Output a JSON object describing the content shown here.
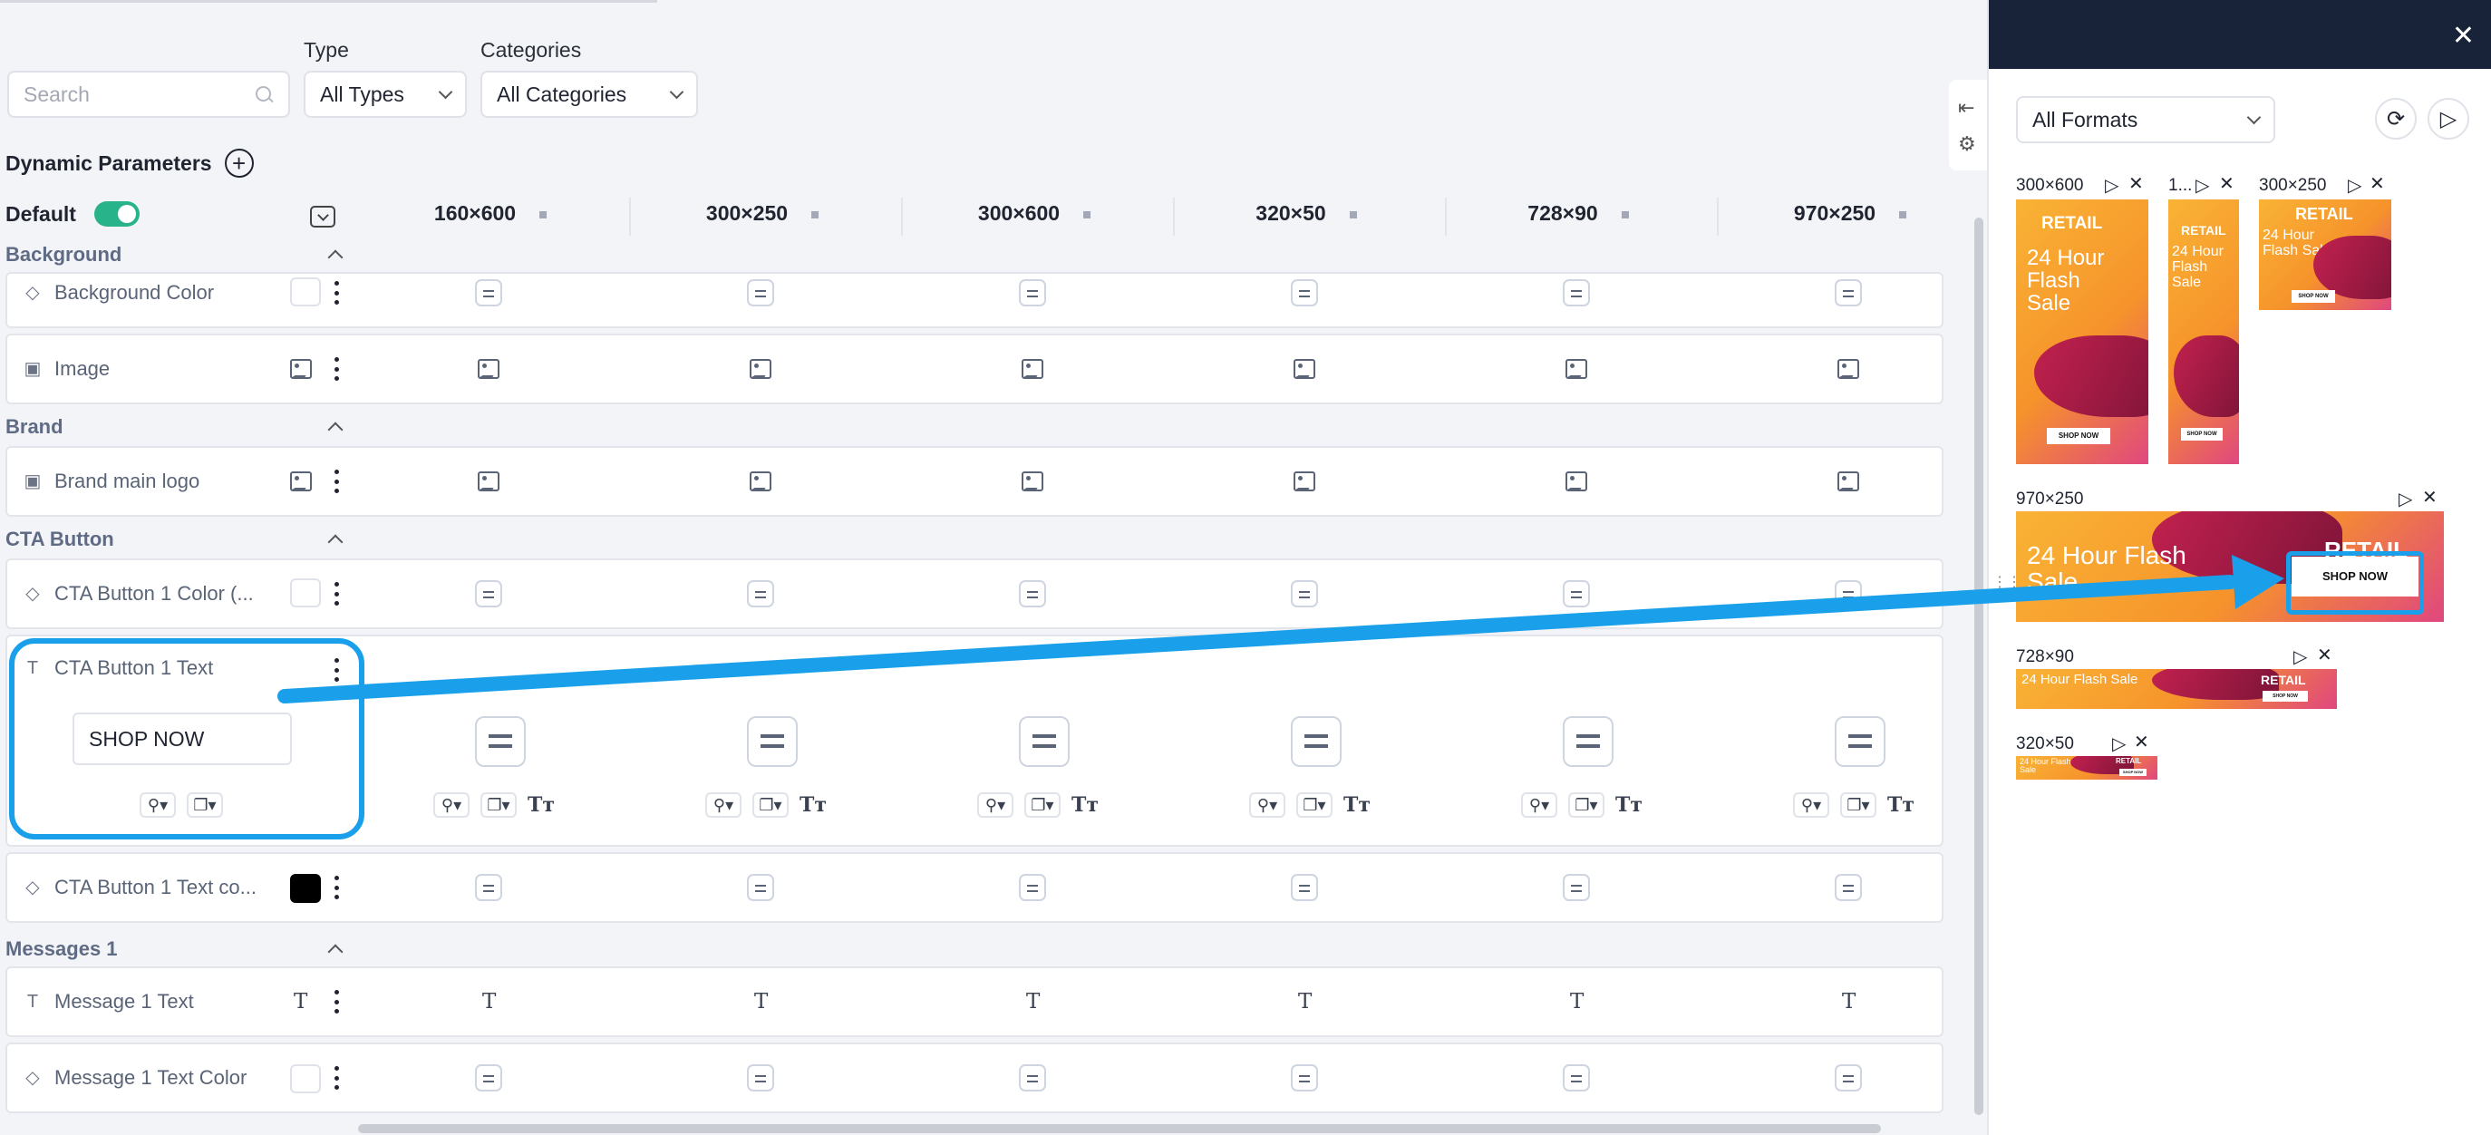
{
  "filters": {
    "search_placeholder": "Search",
    "type_label": "Type",
    "type_value": "All Types",
    "categories_label": "Categories",
    "categories_value": "All Categories"
  },
  "params": {
    "title": "Dynamic Parameters",
    "default_label": "Default",
    "columns": [
      "160×600",
      "300×250",
      "300×600",
      "320×50",
      "728×90",
      "970×250"
    ]
  },
  "sections": {
    "background": "Background",
    "brand": "Brand",
    "cta": "CTA Button",
    "messages": "Messages 1"
  },
  "rows": {
    "bg_color": "Background Color",
    "image": "Image",
    "brand_logo": "Brand main logo",
    "cta_color": "CTA Button 1 Color (...",
    "cta_text": "CTA Button 1 Text",
    "cta_text_value": "SHOP NOW",
    "cta_text_color": "CTA Button 1 Text co...",
    "msg_text": "Message 1 Text",
    "msg_text_color": "Message 1 Text Color"
  },
  "preview": {
    "format_value": "All Formats",
    "close": "✕",
    "labels": {
      "l300x600": "300×600",
      "l160": "1...",
      "l300x250": "300×250",
      "l970x250": "970×250",
      "l728x90": "728×90",
      "l320x50": "320×50"
    },
    "banner": {
      "brand": "RETAIL",
      "headline": "24 Hour Flash Sale",
      "cta": "SHOP NOW"
    }
  },
  "colors": {
    "accent": "#1aa0ea",
    "toggle": "#29b38a",
    "panel_header": "#182238"
  }
}
